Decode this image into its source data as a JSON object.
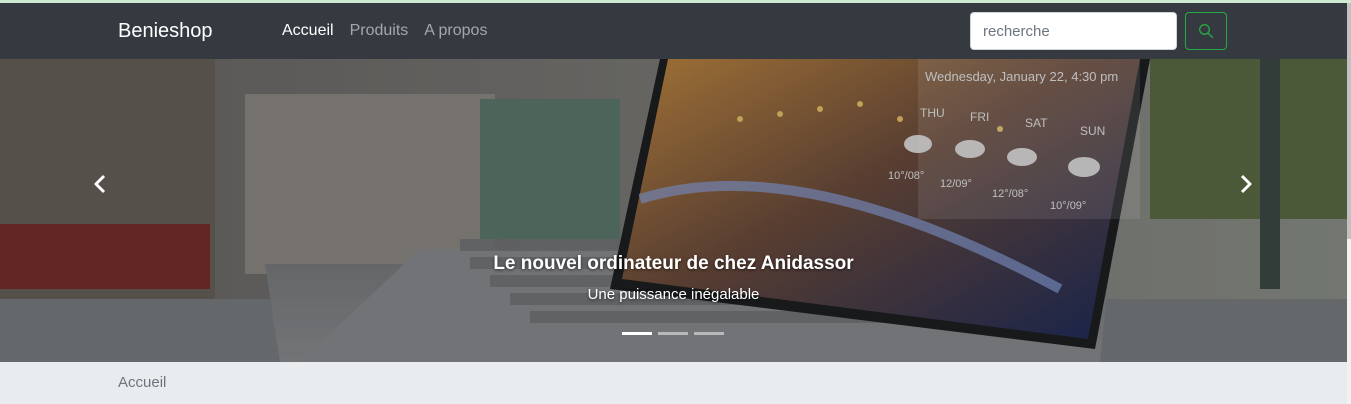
{
  "navbar": {
    "brand": "Benieshop",
    "links": [
      {
        "label": "Accueil",
        "active": true
      },
      {
        "label": "Produits",
        "active": false
      },
      {
        "label": "A propos",
        "active": false
      }
    ],
    "search": {
      "placeholder": "recherche",
      "button_icon": "search-icon"
    }
  },
  "carousel": {
    "caption_title": "Le nouvel ordinateur de chez Anidassor",
    "caption_subtitle": "Une puissance inégalable",
    "prev_icon": "chevron-left-icon",
    "next_icon": "chevron-right-icon",
    "indicators": [
      {
        "active": true
      },
      {
        "active": false
      },
      {
        "active": false
      }
    ],
    "screen_text": {
      "datetime": "Wednesday, January 22, 4:30 pm",
      "days": [
        "THU",
        "FRI",
        "SAT",
        "SUN"
      ],
      "temps": [
        "10°/08°",
        "12/09°",
        "12°/08°",
        "10°/09°"
      ]
    }
  },
  "breadcrumb": {
    "items": [
      "Accueil"
    ]
  },
  "colors": {
    "navbar_bg": "#343a40",
    "search_button_border": "#28a745",
    "breadcrumb_bg": "#e9ecef"
  }
}
